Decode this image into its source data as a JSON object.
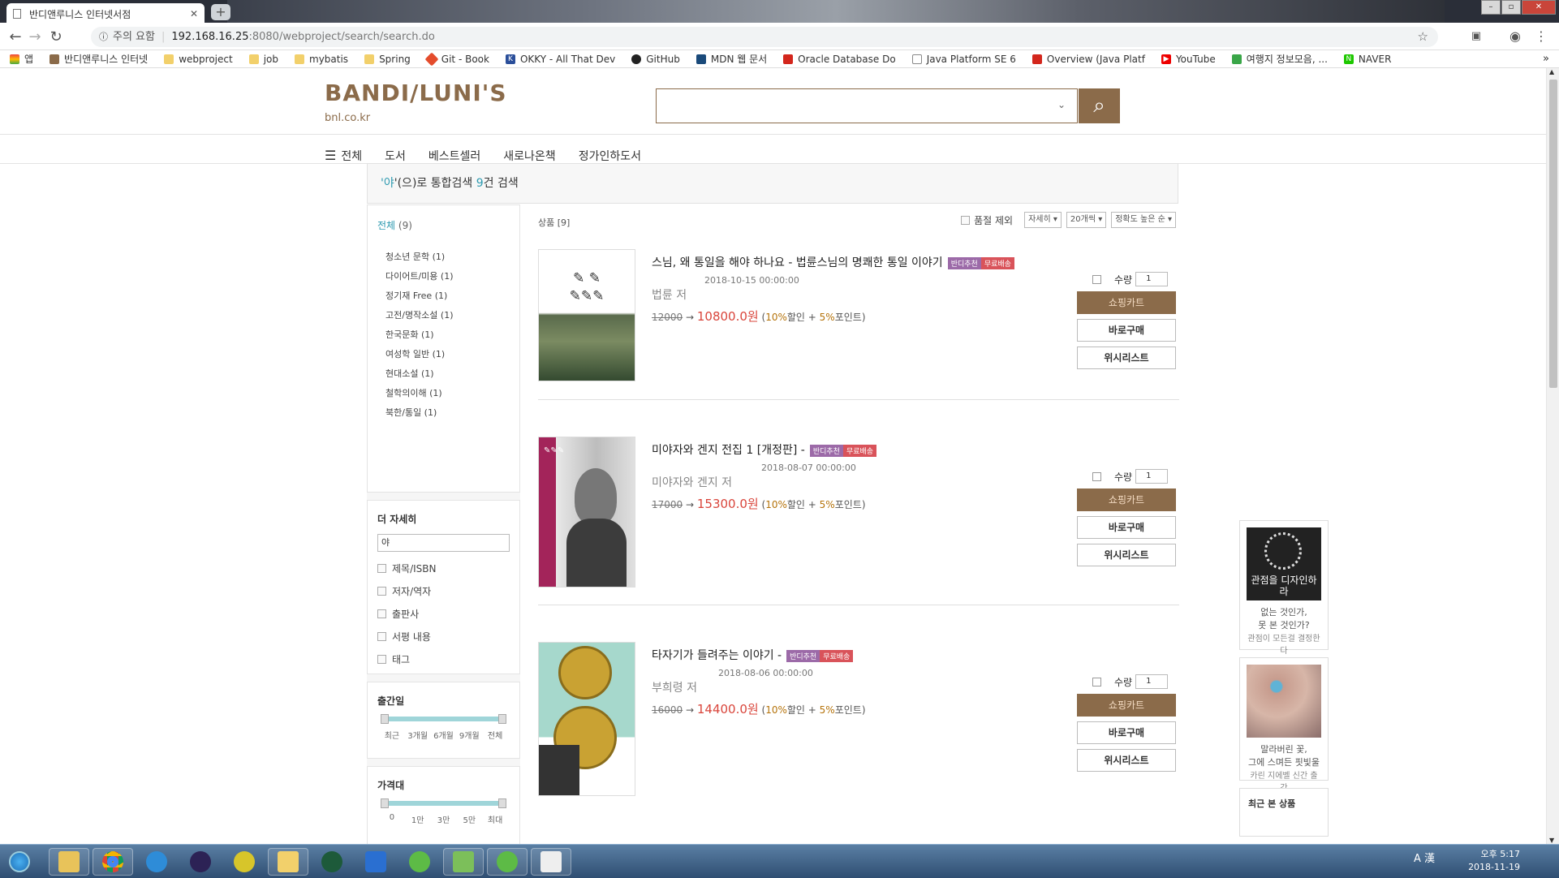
{
  "browser": {
    "tab_title": "반디앤루니스 인터넷서점",
    "new_tab": "+",
    "url_warning": "주의 요함",
    "url_host": "192.168.16.25",
    "url_path": ":8080/webproject/search/search.do",
    "bookmarks": [
      {
        "label": "앱"
      },
      {
        "label": "반디앤루니스 인터넷"
      },
      {
        "label": "webproject"
      },
      {
        "label": "job"
      },
      {
        "label": "mybatis"
      },
      {
        "label": "Spring"
      },
      {
        "label": "Git - Book"
      },
      {
        "label": "OKKY - All That Dev"
      },
      {
        "label": "GitHub"
      },
      {
        "label": "MDN 웹 문서"
      },
      {
        "label": "Oracle Database Do"
      },
      {
        "label": "Java Platform SE 6"
      },
      {
        "label": "Overview (Java Platf"
      },
      {
        "label": "YouTube"
      },
      {
        "label": "여행지 정보모음, ..."
      },
      {
        "label": "NAVER"
      }
    ]
  },
  "header": {
    "logo": "BANDI/LUNI'S",
    "logo_sub": "bnl.co.kr",
    "search_value": "",
    "dropdown": "⌄"
  },
  "gnb": {
    "all": "전체",
    "items": [
      "도서",
      "베스트셀러",
      "새로나온책",
      "정가인하도서"
    ]
  },
  "result": {
    "q_open": "'",
    "query": "야",
    "q_close": "'(으)로 통합검색 ",
    "count": "9",
    "suffix": "건 검색"
  },
  "sidebar": {
    "all_label": "전체",
    "all_count": "(9)",
    "categories": [
      "청소년 문학 (1)",
      "다이어트/미용 (1)",
      "정기재 Free (1)",
      "고전/명작소설 (1)",
      "한국문화 (1)",
      "여성학 일반 (1)",
      "현대소설 (1)",
      "철학의이해 (1)",
      "북한/통일 (1)"
    ],
    "detail_title": "더 자세히",
    "detail_input": "야",
    "detail_options": [
      "제목/ISBN",
      "저자/역자",
      "출판사",
      "서평 내용",
      "태그"
    ],
    "pub_title": "출간일",
    "pub_ticks": [
      "최근",
      "3개월",
      "6개월",
      "9개월",
      "전체"
    ],
    "price_title": "가격대",
    "price_ticks": [
      "0",
      "1만",
      "3만",
      "5만",
      "최대"
    ]
  },
  "list": {
    "header": "상품 [9]",
    "exclude_soldout": "품절 제외",
    "view": "자세히 ▾",
    "per_page": "20개씩 ▾",
    "sort": "정확도 높은 순 ▾",
    "qty_label": "수량",
    "cart": "쇼핑카트",
    "buy": "바로구매",
    "wish": "위시리스트",
    "badge1": "반디추천",
    "badge2": "무료배송",
    "items": [
      {
        "title": "스님, 왜 통일을 해야 하나요 - 법륜스님의 명쾌한 통일 이야기",
        "date": "2018-10-15 00:00:00",
        "author": "법륜 저",
        "orig": "12000",
        "arrow": " → ",
        "sale": "10800.0원",
        "disc_open": " (",
        "disc": "10%",
        "disc_mid": "할인 + ",
        "point": "5%",
        "point_suffix": "포인트)",
        "qty": "1"
      },
      {
        "title": "미야자와 겐지 전집 1 [개정판] -",
        "date": "2018-08-07 00:00:00",
        "author": "미야자와 겐지 저",
        "orig": "17000",
        "arrow": " → ",
        "sale": "15300.0원",
        "disc_open": " (",
        "disc": "10%",
        "disc_mid": "할인 + ",
        "point": "5%",
        "point_suffix": "포인트)",
        "qty": "1"
      },
      {
        "title": "타자기가 들려주는 이야기 -",
        "date": "2018-08-06 00:00:00",
        "author": "부희령 저",
        "orig": "16000",
        "arrow": " → ",
        "sale": "14400.0원",
        "disc_open": " (",
        "disc": "10%",
        "disc_mid": "할인 + ",
        "point": "5%",
        "point_suffix": "포인트)",
        "qty": "1"
      }
    ]
  },
  "aside": {
    "ad1_book": "관점을 디자인하라",
    "ad1_lines": [
      "없는 것인가,",
      "못 본 것인가?"
    ],
    "ad1_tag": "관점이 모든걸 결정한다",
    "ad2_lines": [
      "말라버린 꽃,",
      "그에 스며든 핏빛울"
    ],
    "ad2_tag": "카린 지에벨 신간 출간",
    "recent": "최근 본 상품"
  },
  "taskbar": {
    "ime": "A 漢",
    "time": "오후 5:17",
    "date": "2018-11-19"
  },
  "colors": {
    "brand": "#8b6b4a",
    "accent": "#2e9ab0",
    "sale": "#d9453b"
  }
}
